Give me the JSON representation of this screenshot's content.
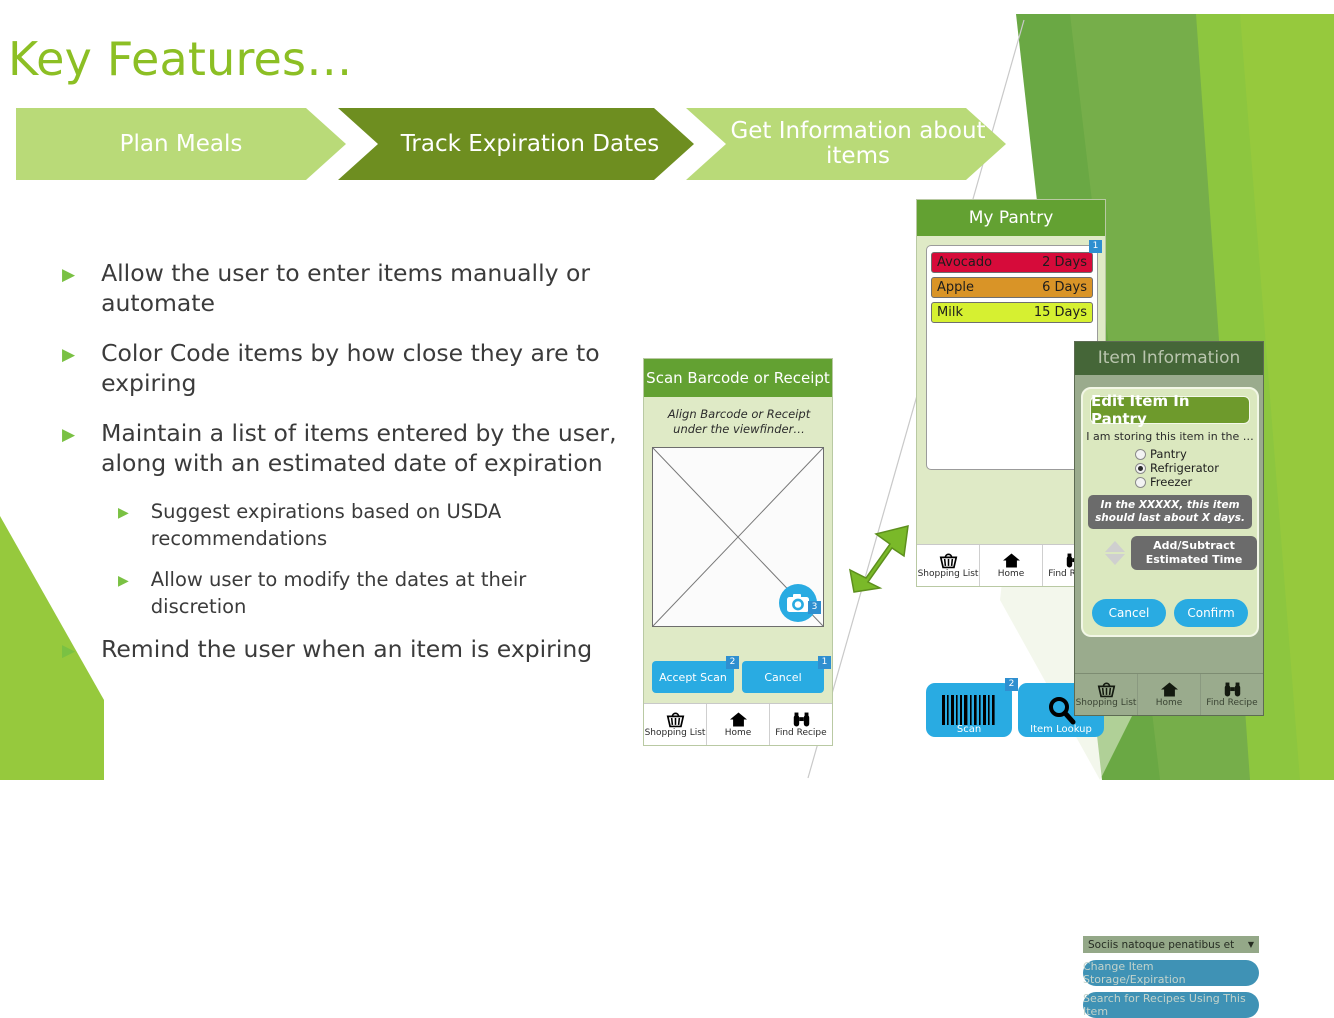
{
  "slide": {
    "title": "Key Features…",
    "title_color": "#8cbf24"
  },
  "chevrons": [
    {
      "label": "Plan Meals",
      "state": "inactive",
      "color": "#b9da78"
    },
    {
      "label": "Track Expiration Dates",
      "state": "active",
      "color": "#6e8e20"
    },
    {
      "label": "Get Information about items",
      "state": "inactive",
      "color": "#b9da78"
    }
  ],
  "bullets": [
    {
      "level": 1,
      "text": "Allow the user to enter items manually or automate"
    },
    {
      "level": 1,
      "text": "Color Code items by how close they are to expiring"
    },
    {
      "level": 1,
      "text": "Maintain a list of items entered by the user, along with an estimated date of expiration"
    },
    {
      "level": 2,
      "text": "Suggest expirations based on USDA recommendations"
    },
    {
      "level": 2,
      "text": "Allow user to modify the dates at their discretion"
    },
    {
      "level": 1,
      "text": "Remind the user when an item is expiring"
    }
  ],
  "mockups": {
    "pantry": {
      "header": "My Pantry",
      "items": [
        {
          "name": "Avocado",
          "days": "2 Days",
          "color": "#d60b3a"
        },
        {
          "name": "Apple",
          "days": "6 Days",
          "color": "#d99427"
        },
        {
          "name": "Milk",
          "days": "15 Days",
          "color": "#d6f031"
        }
      ],
      "list_badge": "1",
      "buttons": [
        {
          "label": "Scan",
          "icon": "barcode-icon",
          "badge": "2"
        },
        {
          "label": "Item Lookup",
          "icon": "magnifier-icon",
          "badge": ""
        }
      ],
      "nav": [
        "Shopping List",
        "Home",
        "Find Recipe"
      ]
    },
    "scan": {
      "header": "Scan Barcode or Receipt",
      "hint": "Align Barcode or Receipt under the viewfinder…",
      "camera_badge": "3",
      "buttons": [
        {
          "label": "Accept Scan",
          "badge": "2"
        },
        {
          "label": "Cancel",
          "badge": "1"
        }
      ],
      "nav": [
        "Shopping List",
        "Home",
        "Find Recipe"
      ]
    },
    "item_information": {
      "header": "Item Information",
      "dropdown_value": "Sociis natoque penatibus et",
      "actions": [
        "Change Item Storage/Expiration",
        "Search for Recipes Using This Item"
      ],
      "nav": [
        "Shopping List",
        "Home",
        "Find Recipe"
      ],
      "modal": {
        "title": "Edit Item In Pantry",
        "question": "I am storing this item in the …",
        "options": [
          {
            "label": "Pantry",
            "selected": false
          },
          {
            "label": "Refrigerator",
            "selected": true
          },
          {
            "label": "Freezer",
            "selected": false
          }
        ],
        "note": "In the XXXXX, this item should last about X days.",
        "stepper_label": "Add/Subtract Estimated Time",
        "cancel_label": "Cancel",
        "confirm_label": "Confirm"
      }
    }
  },
  "colors": {
    "accent_green": "#8cbf24",
    "dark_green": "#6e8e20",
    "light_green": "#b9da78",
    "blue": "#29ABE2",
    "header_green": "#63a132"
  }
}
